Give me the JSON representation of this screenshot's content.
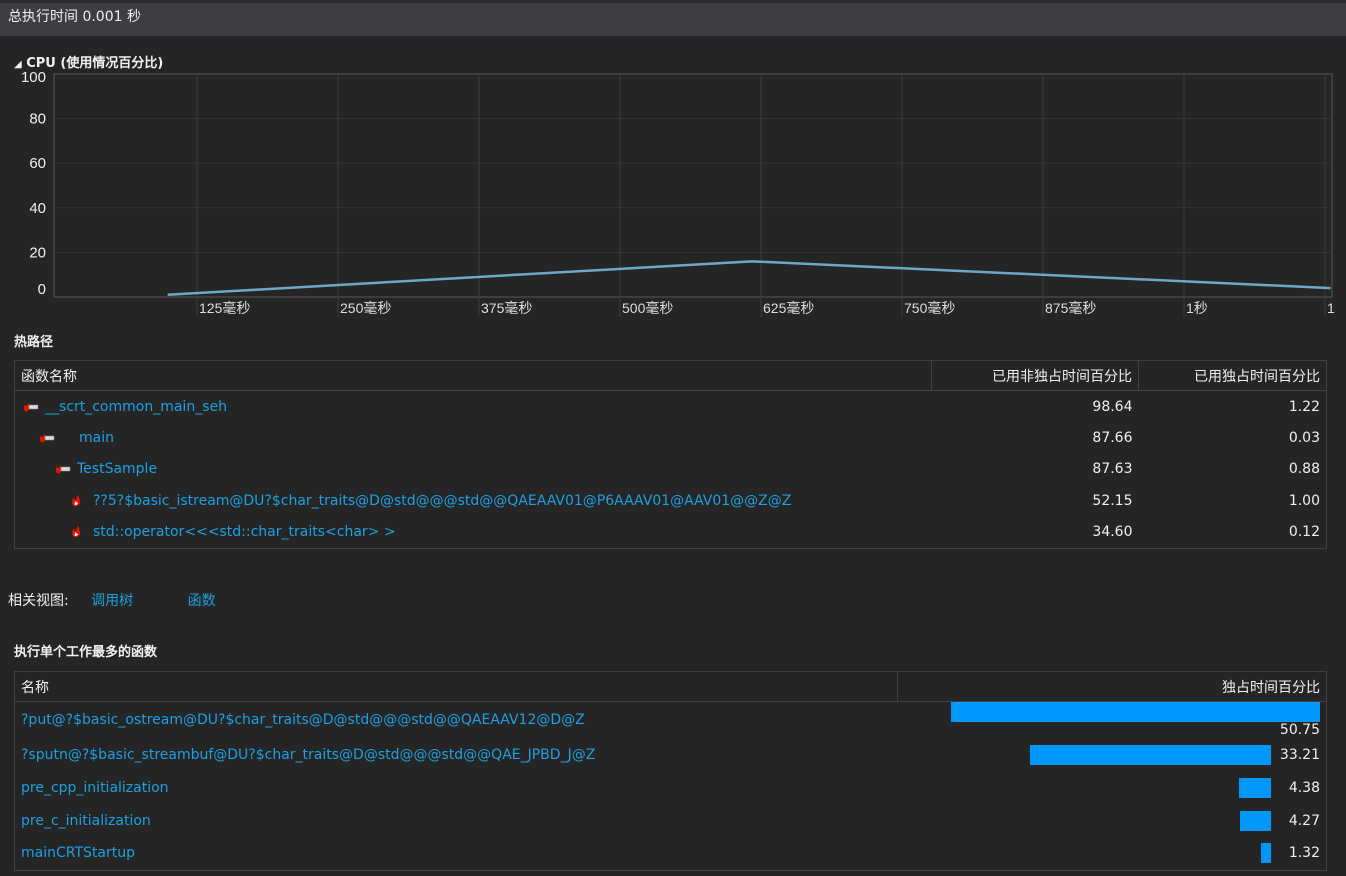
{
  "header": {
    "title": "总执行时间 0.001 秒"
  },
  "cpu": {
    "title": "CPU (使用情况百分比)",
    "collapse_icon": "triangle-collapse-icon"
  },
  "chart_data": {
    "type": "line",
    "title": "CPU (使用情况百分比)",
    "ylim": [
      0,
      100
    ],
    "yticks": [
      "100",
      "80",
      "60",
      "40",
      "20",
      "0"
    ],
    "ytick_values": [
      100,
      80,
      60,
      40,
      20,
      0
    ],
    "xlim_ms": [
      0,
      1130
    ],
    "xticks": [
      "125毫秒",
      "250毫秒",
      "375毫秒",
      "500毫秒",
      "625毫秒",
      "750毫秒",
      "875毫秒",
      "1秒",
      "1"
    ],
    "xtick_values_ms": [
      125,
      250,
      375,
      500,
      625,
      750,
      875,
      1000,
      1125
    ],
    "series": [
      {
        "name": "CPU",
        "color": "#6fa8c4",
        "x_ms": [
          99,
          617,
          1130
        ],
        "y": [
          1,
          16,
          4
        ]
      }
    ],
    "grid": true
  },
  "hotpath": {
    "title": "热路径",
    "columns": [
      "函数名称",
      "已用非独占时间百分比",
      "已用独占时间百分比"
    ],
    "rows": [
      {
        "name": "__scrt_common_main_seh",
        "incl": "98.64",
        "excl": "1.22",
        "level": 0,
        "icon": "hot-path-icon"
      },
      {
        "name": "main",
        "incl": "87.66",
        "excl": "0.03",
        "level": 1,
        "icon": "hot-path-icon"
      },
      {
        "name": "TestSample",
        "incl": "87.63",
        "excl": "0.88",
        "level": 2,
        "icon": "hot-path-icon"
      },
      {
        "name": "??5?$basic_istream@DU?$char_traits@D@std@@@std@@QAEAAV01@P6AAAV01@AAV01@@Z@Z",
        "incl": "52.15",
        "excl": "1.00",
        "level": 3,
        "icon": "flame-icon"
      },
      {
        "name": "std::operator<<<std::char_traits<char> >",
        "incl": "34.60",
        "excl": "0.12",
        "level": 3,
        "icon": "flame-icon"
      }
    ]
  },
  "related": {
    "label": "相关视图:",
    "links": [
      "调用树",
      "函数"
    ]
  },
  "topfuncs": {
    "title": "执行单个工作最多的函数",
    "columns": [
      "名称",
      "独占时间百分比"
    ],
    "bar_color": "#0097fb",
    "rows": [
      {
        "name": "?put@?$basic_ostream@DU?$char_traits@D@std@@@std@@QAEAAV12@D@Z",
        "value": "50.75",
        "pct": 50.75
      },
      {
        "name": "?sputn@?$basic_streambuf@DU?$char_traits@D@std@@@std@@QAE_JPBD_J@Z",
        "value": "33.21",
        "pct": 33.21
      },
      {
        "name": "pre_cpp_initialization",
        "value": "4.38",
        "pct": 4.38
      },
      {
        "name": "pre_c_initialization",
        "value": "4.27",
        "pct": 4.27
      },
      {
        "name": "mainCRTStartup",
        "value": "1.32",
        "pct": 1.32
      }
    ]
  }
}
